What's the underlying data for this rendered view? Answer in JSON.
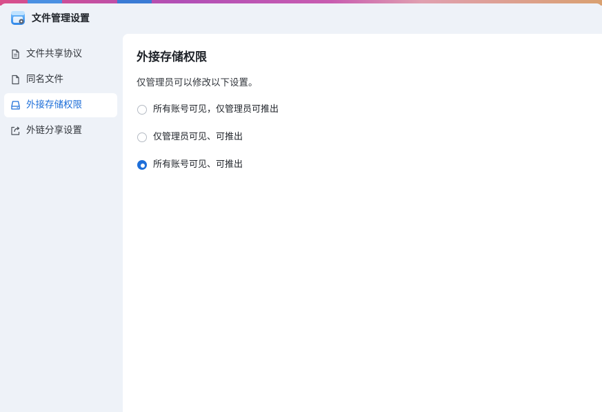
{
  "window": {
    "title": "文件管理设置",
    "app_icon": "file-manager-settings-icon"
  },
  "sidebar": {
    "items": [
      {
        "label": "文件共享协议",
        "icon": "document-icon",
        "active": false
      },
      {
        "label": "同名文件",
        "icon": "file-icon",
        "active": false
      },
      {
        "label": "外接存储权限",
        "icon": "external-drive-icon",
        "active": true
      },
      {
        "label": "外链分享设置",
        "icon": "share-link-icon",
        "active": false
      }
    ]
  },
  "main": {
    "title": "外接存储权限",
    "description": "仅管理员可以修改以下设置。",
    "options": [
      {
        "label": "所有账号可见，仅管理员可推出",
        "checked": false
      },
      {
        "label": "仅管理员可见、可推出",
        "checked": false
      },
      {
        "label": "所有账号可见、可推出",
        "checked": true
      }
    ]
  },
  "colors": {
    "accent": "#1e6fd9",
    "sidebar_bg": "#eef2f8",
    "content_bg": "#ffffff"
  }
}
